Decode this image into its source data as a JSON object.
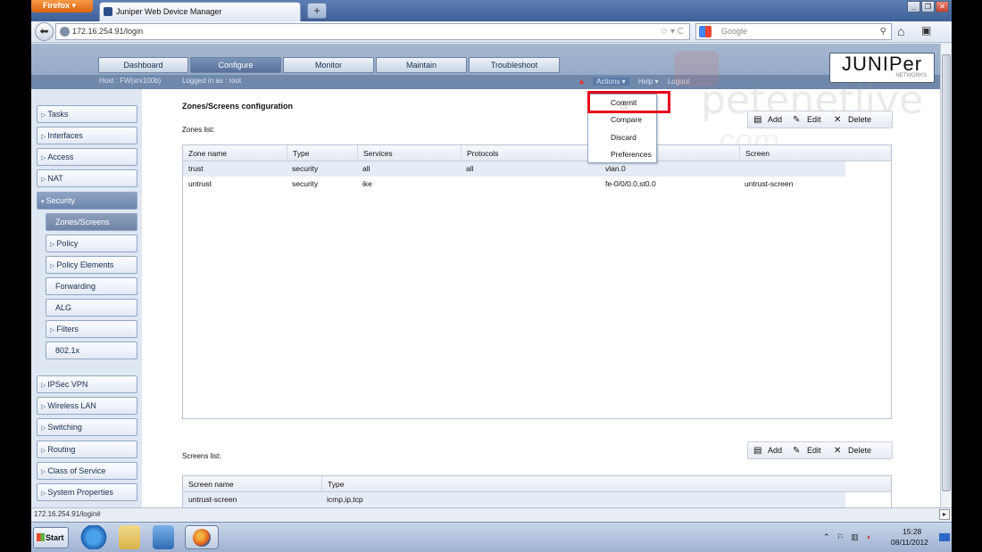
{
  "browser": {
    "app_button": "Firefox",
    "tab_title": "Juniper Web Device Manager",
    "new_tab": "+",
    "url": "172.16.254.91/login",
    "search_placeholder": "Google",
    "status_url": "172.16.254.91/login#"
  },
  "header": {
    "nav": [
      "Dashboard",
      "Configure",
      "Monitor",
      "Maintain",
      "Troubleshoot"
    ],
    "active_nav": "Configure",
    "host": "Host : FW(srx100b)",
    "logged_in": "Logged in as : root",
    "menu": [
      "Actions",
      "Help",
      "Logout"
    ],
    "logo": "JUNIPer",
    "logo_sub": "NETWORKS"
  },
  "watermark": {
    "line1": "petenetlive",
    "line2": ".com"
  },
  "sidebar": {
    "items": [
      "Tasks",
      "Interfaces",
      "Access",
      "NAT",
      "Security"
    ],
    "security_children": [
      "Zones/Screens",
      "Policy",
      "Policy Elements",
      "Forwarding",
      "ALG",
      "Filters",
      "802.1x"
    ],
    "more_items": [
      "IPSec VPN",
      "Wireless LAN",
      "Switching",
      "Routing",
      "Class of Service",
      "System Properties"
    ]
  },
  "main": {
    "title": "Zones/Screens configuration",
    "zones_label": "Zones list:",
    "toolbar": {
      "add": "Add",
      "edit": "Edit",
      "delete": "Delete"
    },
    "zones_columns": [
      "Zone name",
      "Type",
      "Services",
      "Protocols",
      "",
      "Screen"
    ],
    "zones_rows": [
      [
        "trust",
        "security",
        "all",
        "all",
        "vlan.0",
        ""
      ],
      [
        "untrust",
        "security",
        "ike",
        "",
        "fe-0/0/0.0,st0.0",
        "untrust-screen"
      ]
    ],
    "screens_label": "Screens list:",
    "screens_columns": [
      "Screen name",
      "Type"
    ],
    "screens_rows": [
      [
        "untrust-screen",
        "icmp,ip,tcp"
      ]
    ]
  },
  "actions_menu": [
    "Commit",
    "Compare",
    "Discard",
    "Preferences"
  ],
  "taskbar": {
    "start": "Start",
    "time": "15:28",
    "date": "08/11/2012"
  },
  "colors": {
    "highlight": "#e8001c",
    "header": "#8ea4c2"
  }
}
